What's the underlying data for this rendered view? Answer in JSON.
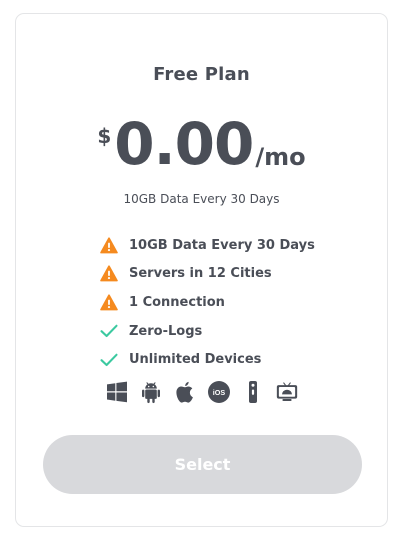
{
  "plan": {
    "title": "Free Plan",
    "currency": "$",
    "price": "0.00",
    "period": "/mo",
    "subtitle": "10GB Data Every 30 Days"
  },
  "features": [
    {
      "label": "10GB Data Every 30 Days",
      "icon": "warning-icon"
    },
    {
      "label": "Servers in 12 Cities",
      "icon": "warning-icon"
    },
    {
      "label": "1 Connection",
      "icon": "warning-icon"
    },
    {
      "label": "Zero-Logs",
      "icon": "check-icon"
    },
    {
      "label": "Unlimited Devices",
      "icon": "check-icon"
    }
  ],
  "platforms": [
    {
      "icon": "windows-icon"
    },
    {
      "icon": "android-icon"
    },
    {
      "icon": "apple-icon"
    },
    {
      "icon": "ios-icon",
      "label": "iOS"
    },
    {
      "icon": "remote-icon"
    },
    {
      "icon": "android-tv-icon"
    }
  ],
  "action": {
    "label": "Select"
  },
  "colors": {
    "text": "#4a4e57",
    "warning": "#f58a1f",
    "check": "#3bc9a0",
    "button_bg": "#d8d9dc",
    "platform_icon": "#4a4e57"
  }
}
